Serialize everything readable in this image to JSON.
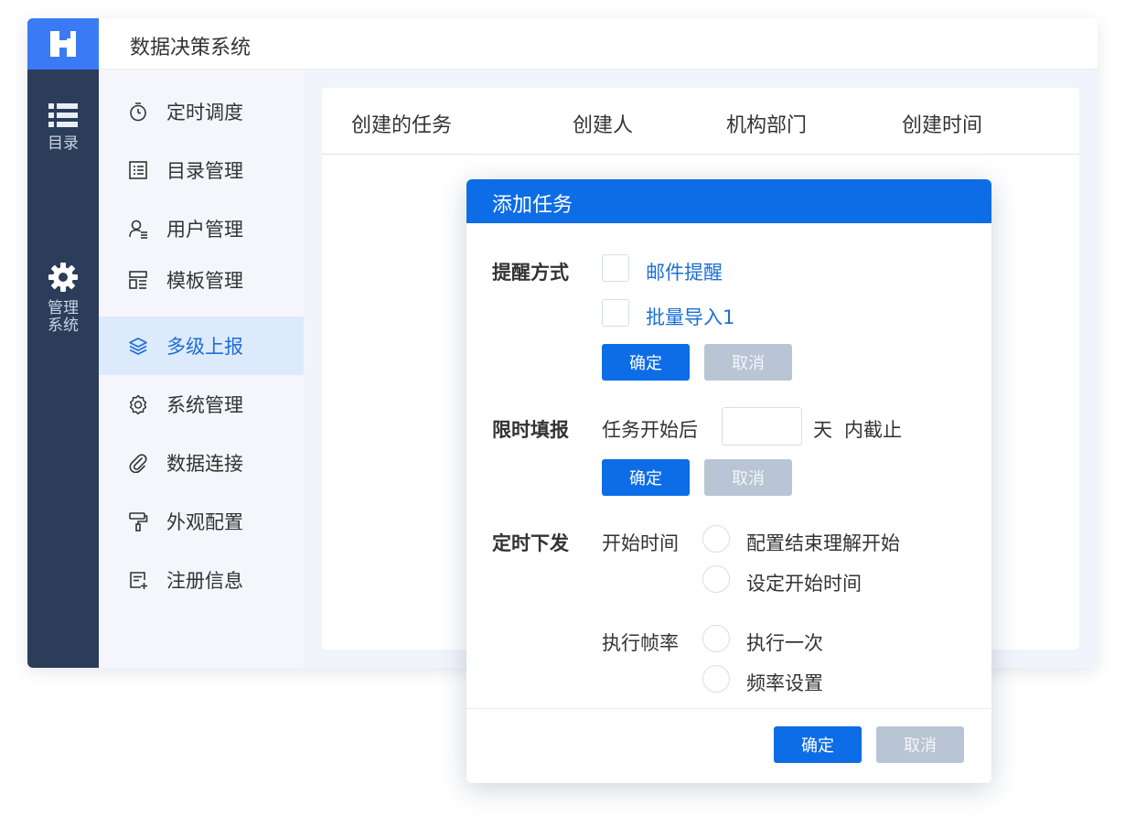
{
  "app": {
    "title": "数据决策系统"
  },
  "rail": {
    "items": [
      {
        "label": "目录",
        "icon": "list-icon"
      },
      {
        "label": "管理系统",
        "icon": "gear-icon"
      }
    ]
  },
  "sidebar": {
    "items": [
      {
        "label": "定时调度",
        "icon": "timer-icon"
      },
      {
        "label": "目录管理",
        "icon": "catalog-icon"
      },
      {
        "label": "用户管理",
        "icon": "user-icon"
      },
      {
        "label": "模板管理",
        "icon": "template-icon"
      },
      {
        "label": "多级上报",
        "icon": "layers-icon",
        "active": true
      },
      {
        "label": "系统管理",
        "icon": "settings-icon"
      },
      {
        "label": "数据连接",
        "icon": "paperclip-icon"
      },
      {
        "label": "外观配置",
        "icon": "paint-roller-icon"
      },
      {
        "label": "注册信息",
        "icon": "register-icon"
      }
    ]
  },
  "table": {
    "headers": [
      "创建的任务",
      "创建人",
      "机构部门",
      "创建时间"
    ]
  },
  "dialog": {
    "title": "添加任务",
    "reminder": {
      "label": "提醒方式",
      "options": [
        "邮件提醒",
        "批量导入1"
      ],
      "confirm": "确定",
      "cancel": "取消"
    },
    "deadline": {
      "label": "限时填报",
      "prefix": "任务开始后",
      "value": "",
      "unit": "天",
      "suffix": "内截止",
      "confirm": "确定",
      "cancel": "取消"
    },
    "schedule": {
      "label": "定时下发",
      "start_label": "开始时间",
      "start_options": [
        "配置结束理解开始",
        "设定开始时间"
      ],
      "freq_label": "执行帧率",
      "freq_options": [
        "执行一次",
        "频率设置"
      ]
    },
    "footer": {
      "confirm": "确定",
      "cancel": "取消"
    }
  },
  "colors": {
    "accent": "#0c6de6",
    "rail_bg": "#2b3d59",
    "logo_bg": "#3a7bf5",
    "active_bg": "#ddeafc",
    "disabled_btn": "#b9c5d4"
  }
}
